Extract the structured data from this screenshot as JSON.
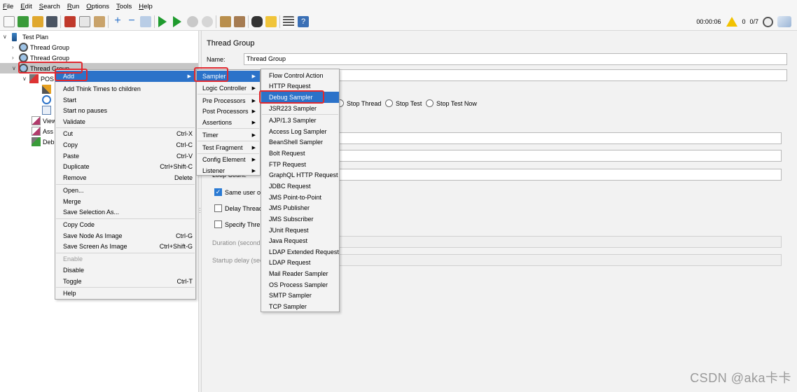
{
  "menubar": [
    "File",
    "Edit",
    "Search",
    "Run",
    "Options",
    "Tools",
    "Help"
  ],
  "toolbar": {
    "timer": "00:00:06",
    "warnings": "0",
    "threads": "0/7"
  },
  "tree": {
    "test_plan": "Test Plan",
    "thread_group_1": "Thread Group",
    "thread_group_2": "Thread Group",
    "thread_group_3": "Thread Group",
    "child_pos": "POS",
    "child_view": "View",
    "child_ass": "Ass",
    "child_deb": "Deb"
  },
  "panel": {
    "title": "Thread Group",
    "name_label": "Name:",
    "name_value": "Thread Group",
    "stop_thread": "Stop Thread",
    "stop_test": "Stop Test",
    "stop_test_now": "Stop Test Now",
    "loop_count": "Loop Count:",
    "same_user": "Same user o",
    "delay_thread": "Delay Thread",
    "specify_thread": "Specify Thre",
    "duration": "Duration (second",
    "startup_delay": "Startup delay (sec"
  },
  "context_menu": {
    "add": "Add",
    "add_think_times": "Add Think Times to children",
    "start": "Start",
    "start_no_pauses": "Start no pauses",
    "validate": "Validate",
    "cut": "Cut",
    "cut_sc": "Ctrl-X",
    "copy": "Copy",
    "copy_sc": "Ctrl-C",
    "paste": "Paste",
    "paste_sc": "Ctrl-V",
    "duplicate": "Duplicate",
    "duplicate_sc": "Ctrl+Shift-C",
    "remove": "Remove",
    "remove_sc": "Delete",
    "open": "Open...",
    "merge": "Merge",
    "save_selection": "Save Selection As...",
    "copy_code": "Copy Code",
    "save_node_image": "Save Node As Image",
    "save_node_image_sc": "Ctrl-G",
    "save_screen_image": "Save Screen As Image",
    "save_screen_image_sc": "Ctrl+Shift-G",
    "enable": "Enable",
    "disable": "Disable",
    "toggle": "Toggle",
    "toggle_sc": "Ctrl-T",
    "help": "Help"
  },
  "add_menu": [
    "Sampler",
    "Logic Controller",
    "Pre Processors",
    "Post Processors",
    "Assertions",
    "Timer",
    "Test Fragment",
    "Config Element",
    "Listener"
  ],
  "sampler_menu": [
    "Flow Control Action",
    "HTTP Request",
    "Debug Sampler",
    "JSR223 Sampler",
    "AJP/1.3 Sampler",
    "Access Log Sampler",
    "BeanShell Sampler",
    "Bolt Request",
    "FTP Request",
    "GraphQL HTTP Request",
    "JDBC Request",
    "JMS Point-to-Point",
    "JMS Publisher",
    "JMS Subscriber",
    "JUnit Request",
    "Java Request",
    "LDAP Extended Request",
    "LDAP Request",
    "Mail Reader Sampler",
    "OS Process Sampler",
    "SMTP Sampler",
    "TCP Sampler"
  ],
  "watermark": "CSDN @aka卡卡",
  "colors": {
    "highlight": "#2b72c9",
    "annotation": "#e0282f"
  }
}
